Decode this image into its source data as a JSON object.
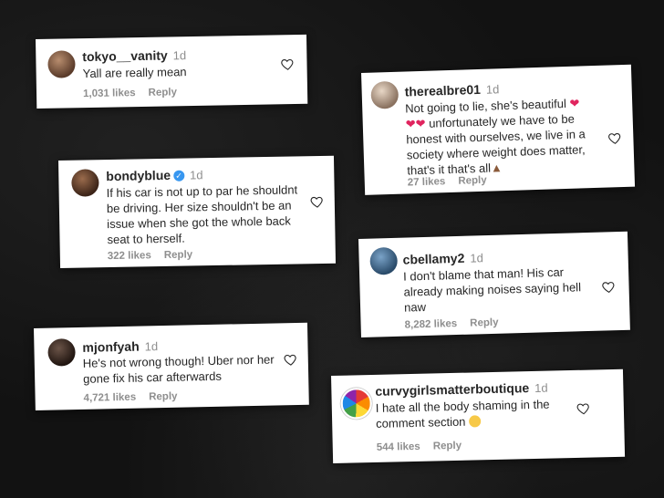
{
  "comments": [
    {
      "username": "tokyo__vanity",
      "time": "1d",
      "text": "Yall are really mean",
      "likes": "1,031 likes",
      "reply": "Reply"
    },
    {
      "username": "therealbre01",
      "time": "1d",
      "line1": "Not going to lie, she's beautiful",
      "line2": "unfortunately we have to be",
      "line3": "honest with ourselves, we live in a",
      "line4": "society where weight does matter,",
      "line5": "that's it that's all",
      "likes": "27 likes",
      "reply": "Reply"
    },
    {
      "username": "bondyblue",
      "time": "1d",
      "line1": "If his car is not up to par he shouldnt",
      "line2": "be driving. Her size shouldn't be an",
      "line3": "issue when she got the whole back",
      "line4": "seat to herself.",
      "likes": "322 likes",
      "reply": "Reply"
    },
    {
      "username": "cbellamy2",
      "time": "1d",
      "line1": "I don't blame that man! His car",
      "line2": "already making noises saying hell",
      "line3": "naw",
      "likes": "8,282 likes",
      "reply": "Reply"
    },
    {
      "username": "mjonfyah",
      "time": "1d",
      "line1": "He's not wrong though! Uber nor her",
      "line2": "gone fix his car afterwards",
      "likes": "4,721 likes",
      "reply": "Reply"
    },
    {
      "username": "curvygirlsmatterboutique",
      "time": "1d",
      "line1": "I hate all the body shaming in the",
      "line2": "comment section",
      "likes": "544 likes",
      "reply": "Reply"
    }
  ],
  "icons": {
    "heart": "heart-outline-icon",
    "verified": "verified-badge-icon"
  },
  "colors": {
    "background": "#121212",
    "card": "#ffffff",
    "username": "#262626",
    "muted": "#8e8e8e",
    "verified": "#3897f0"
  }
}
